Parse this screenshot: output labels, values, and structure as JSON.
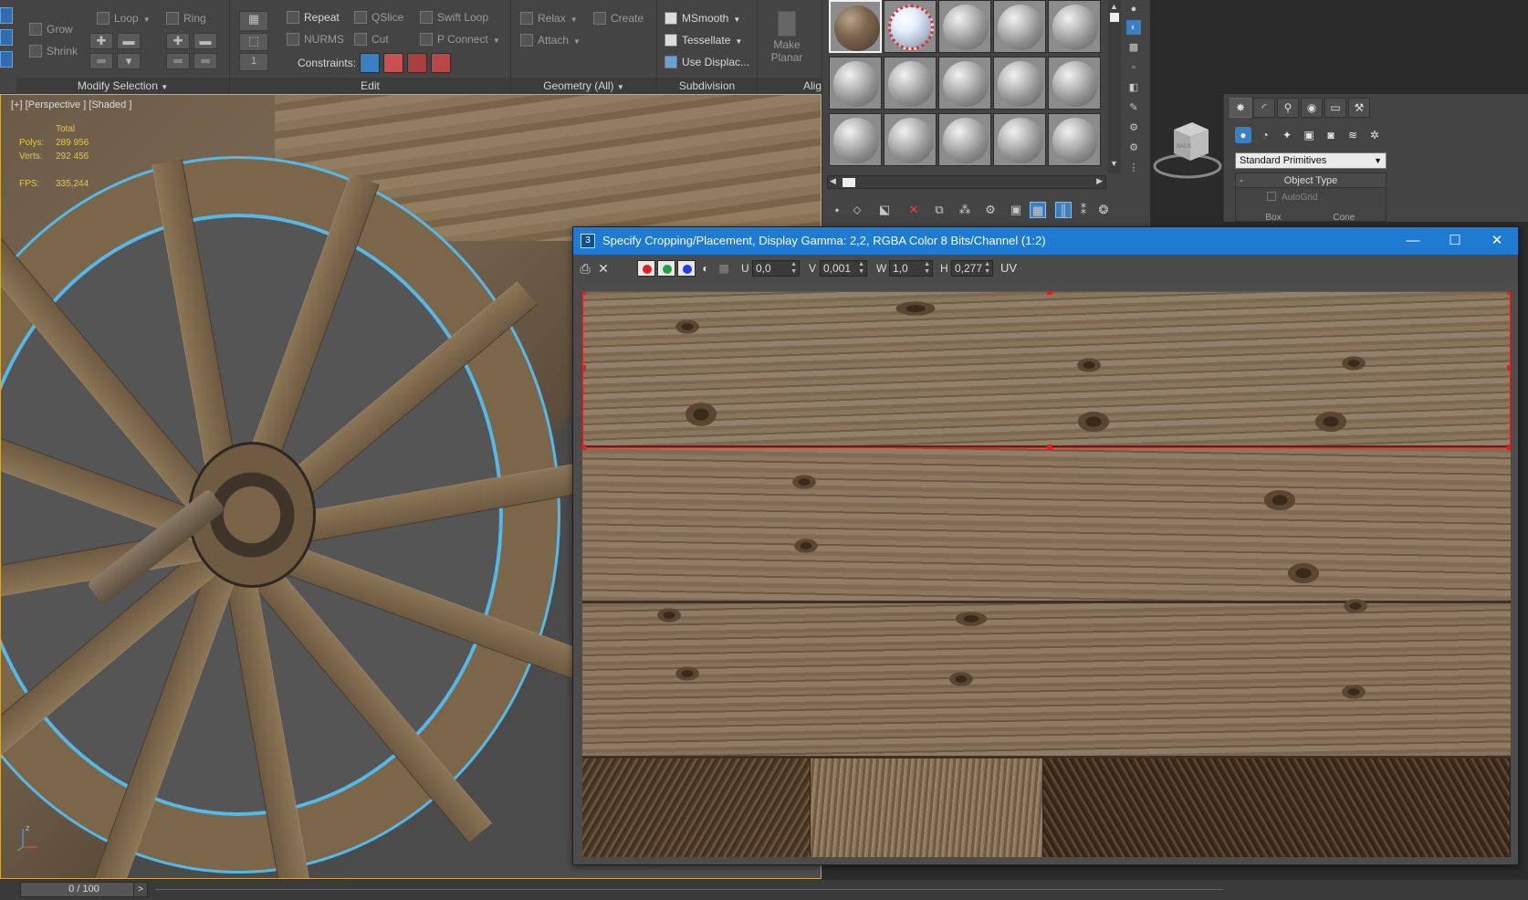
{
  "ribbon": {
    "modify_selection": {
      "label": "Modify Selection",
      "grow": "Grow",
      "shrink": "Shrink",
      "loop": "Loop",
      "ring": "Ring"
    },
    "edit": {
      "label": "Edit",
      "repeat": "Repeat",
      "qslice": "QSlice",
      "swift_loop": "Swift Loop",
      "nurms": "NURMS",
      "cut": "Cut",
      "p_connect": "P Connect",
      "constraints": "Constraints:",
      "spinner_value": "1"
    },
    "geometry": {
      "label": "Geometry (All)",
      "relax": "Relax",
      "create": "Create",
      "attach": "Attach"
    },
    "subdivision": {
      "label": "Subdivision",
      "msmooth": "MSmooth",
      "tessellate": "Tessellate",
      "use_displace": "Use Displac..."
    },
    "align": {
      "label": "Alig",
      "make_planar_line1": "Make",
      "make_planar_line2": "Planar"
    }
  },
  "viewport": {
    "label": "[+] [Perspective ] [Shaded ]",
    "stats": {
      "total_label": "Total",
      "polys_label": "Polys:",
      "polys_value": "289 956",
      "verts_label": "Verts:",
      "verts_value": "292 456",
      "fps_label": "FPS:",
      "fps_value": "335,244"
    },
    "gizmo_z": "z"
  },
  "command_panel": {
    "dropdown_value": "Standard Primitives",
    "rollout_title": "Object Type",
    "autogrid": "AutoGrid",
    "box": "Box",
    "cone": "Cone",
    "viewcube_label": "BACK"
  },
  "crop_dialog": {
    "title": "Specify Cropping/Placement, Display Gamma: 2,2, RGBA Color 8 Bits/Channel (1:2)",
    "u_label": "U",
    "u_value": "0,0",
    "v_label": "V",
    "v_value": "0,001",
    "w_label": "W",
    "w_value": "1,0",
    "h_label": "H",
    "h_value": "0,277",
    "uv_label": "UV",
    "colors": {
      "titlebar": "#1f7bd1",
      "red_channel": "#e02020",
      "green_channel": "#20a040",
      "blue_channel": "#2040e0",
      "crop_outline": "#e0201f"
    }
  },
  "statusbar": {
    "time": "0 / 100",
    "next": ">"
  },
  "colors": {
    "selection_outline": "#55b9e8",
    "active_viewport_border": "#d4aa3a",
    "stats_text": "#e0c84a"
  }
}
